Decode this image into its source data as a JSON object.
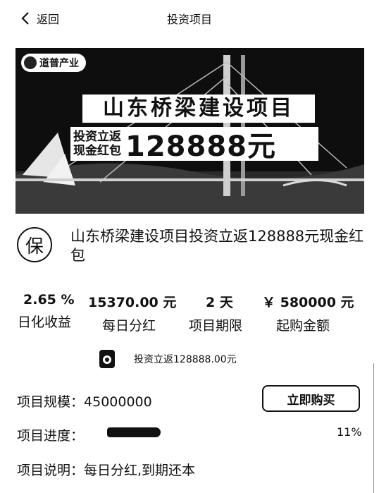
{
  "nav": {
    "back_label": "返回",
    "title": "投资项目"
  },
  "banner": {
    "logo_text": "道普产业",
    "title": "山东桥梁建设项目",
    "sub_line1": "投资立返",
    "sub_line2": "现金红包",
    "amount": "128888元"
  },
  "product": {
    "badge": "保",
    "name": "山东桥梁建设项目投资立返128888元现金红包"
  },
  "stats": [
    {
      "value": "2.65 %",
      "label": "日化收益"
    },
    {
      "value": "15370.00 元",
      "label": "每日分红"
    },
    {
      "value": "2 天",
      "label": "项目期限"
    },
    {
      "value": "￥ 580000 元",
      "label": "起购金额"
    }
  ],
  "rebate_text": "投资立返128888.00元",
  "scale": {
    "label": "项目规模：",
    "value": "45000000"
  },
  "buy_button": "立即购买",
  "progress": {
    "label": "项目进度：",
    "percent_text": "11%",
    "fraction": 0.11
  },
  "description": {
    "label": "项目说明：",
    "value": "每日分红,到期还本"
  }
}
